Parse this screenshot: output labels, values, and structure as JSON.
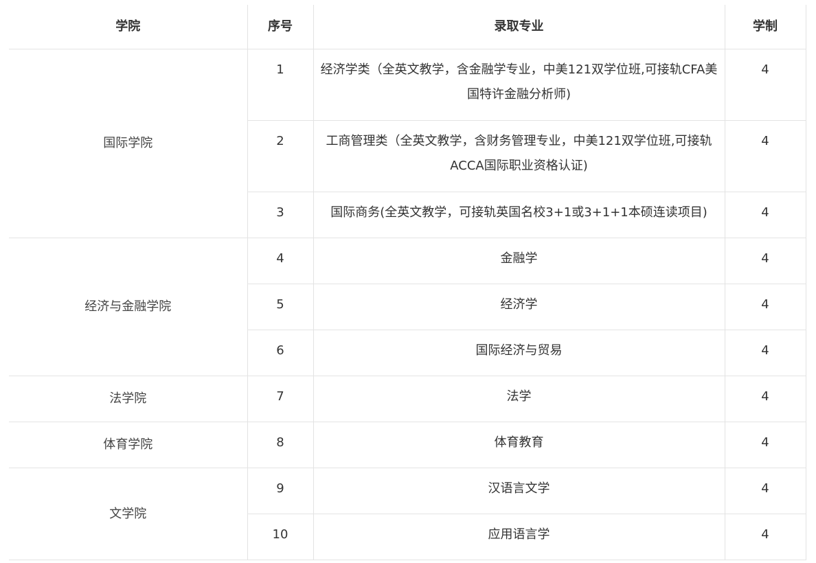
{
  "table": {
    "headers": [
      "学院",
      "序号",
      "录取专业",
      "学制"
    ],
    "groups": [
      {
        "college": "国际学院",
        "rows": [
          {
            "num": "1",
            "major": "经济学类（全英文教学，含金融学专业，中美121双学位班,可接轨CFA美国特许金融分析师)",
            "years": "4"
          },
          {
            "num": "2",
            "major": "工商管理类（全英文教学，含财务管理专业，中美121双学位班,可接轨ACCA国际职业资格认证)",
            "years": "4"
          },
          {
            "num": "3",
            "major": "国际商务(全英文教学，可接轨英国名校3+1或3+1+1本硕连读项目)",
            "years": "4"
          }
        ]
      },
      {
        "college": "经济与金融学院",
        "rows": [
          {
            "num": "4",
            "major": "金融学",
            "years": "4"
          },
          {
            "num": "5",
            "major": "经济学",
            "years": "4"
          },
          {
            "num": "6",
            "major": "国际经济与贸易",
            "years": "4"
          }
        ]
      },
      {
        "college": "法学院",
        "rows": [
          {
            "num": "7",
            "major": "法学",
            "years": "4"
          }
        ]
      },
      {
        "college": "体育学院",
        "rows": [
          {
            "num": "8",
            "major": "体育教育",
            "years": "4"
          }
        ]
      },
      {
        "college": "文学院",
        "rows": [
          {
            "num": "9",
            "major": "汉语言文学",
            "years": "4"
          },
          {
            "num": "10",
            "major": "应用语言学",
            "years": "4"
          }
        ]
      }
    ]
  }
}
